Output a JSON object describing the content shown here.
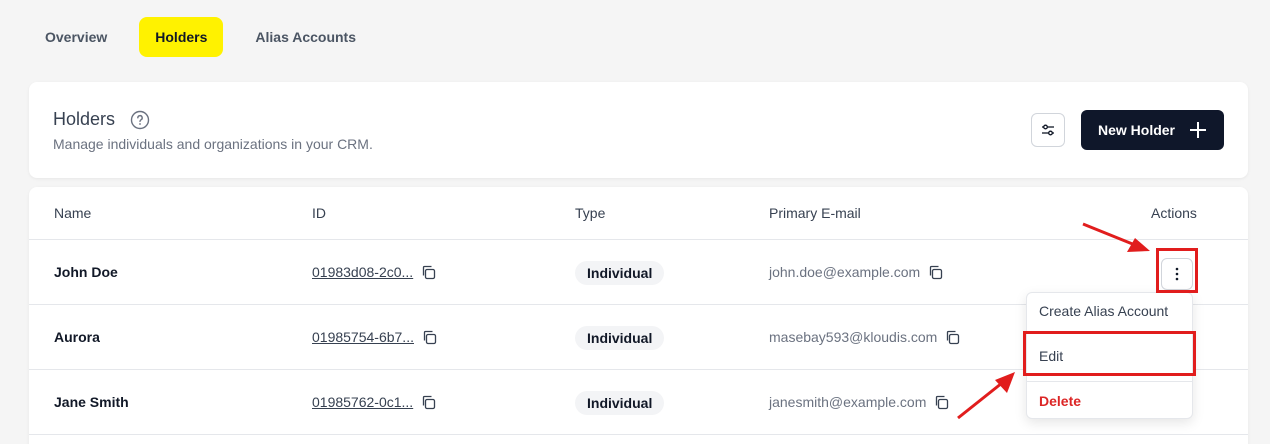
{
  "tabs": [
    {
      "label": "Overview",
      "active": false
    },
    {
      "label": "Holders",
      "active": true
    },
    {
      "label": "Alias Accounts",
      "active": false
    }
  ],
  "header": {
    "title": "Holders",
    "subtitle": "Manage individuals and organizations in your CRM.",
    "new_button_label": "New Holder"
  },
  "table": {
    "columns": [
      "Name",
      "ID",
      "Type",
      "Primary E-mail",
      "Actions"
    ],
    "rows": [
      {
        "name": "John Doe",
        "id": "01983d08-2c0...",
        "type": "Individual",
        "email": "john.doe@example.com"
      },
      {
        "name": "Aurora",
        "id": "01985754-6b7...",
        "type": "Individual",
        "email": "masebay593@kloudis.com"
      },
      {
        "name": "Jane Smith",
        "id": "01985762-0c1...",
        "type": "Individual",
        "email": "janesmith@example.com"
      }
    ]
  },
  "actions_menu": {
    "items": [
      "Create Alias Account",
      "Edit",
      "Delete"
    ]
  },
  "colors": {
    "accent": "#fff200",
    "primary_button": "#0f172a",
    "annotation": "#e11d1d",
    "danger": "#dc2626"
  }
}
